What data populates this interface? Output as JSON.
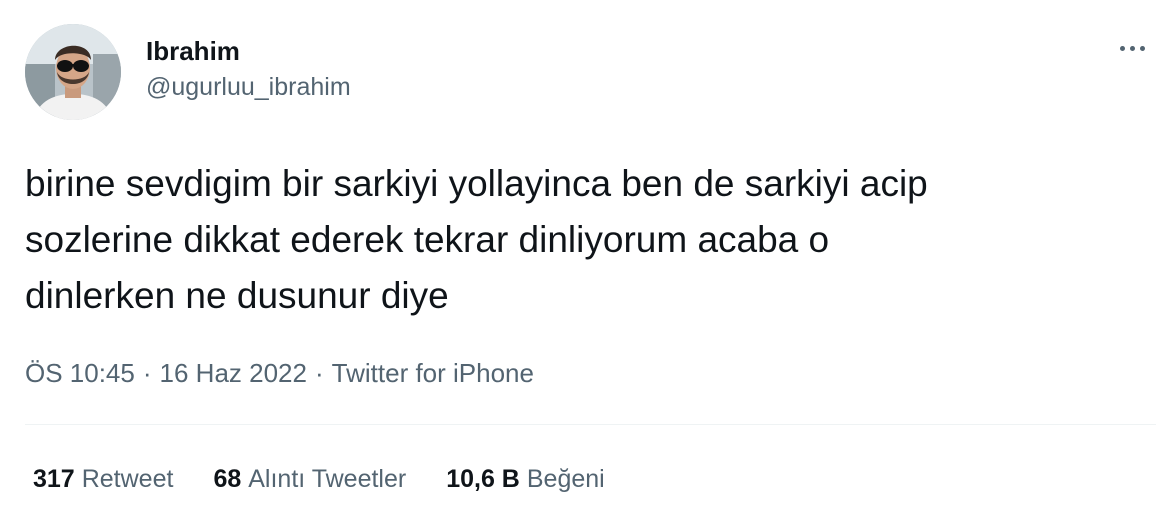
{
  "author": {
    "display_name": "Ibrahim",
    "handle": "@ugurluu_ibrahim",
    "avatar_icon": "user-avatar-photo"
  },
  "more_icon": "more-horizontal-icon",
  "tweet": {
    "text": "birine sevdigim bir sarkiyi yollayinca ben de sarkiyi acip\nsozlerine dikkat ederek tekrar dinliyorum acaba o\ndinlerken ne dusunur diye"
  },
  "meta": {
    "time": "ÖS 10:45",
    "separator": "·",
    "date": "16 Haz 2022",
    "source": "Twitter for iPhone"
  },
  "stats": {
    "retweets": {
      "count": "317",
      "label": "Retweet"
    },
    "quotes": {
      "count": "68",
      "label": "Alıntı Tweetler"
    },
    "likes": {
      "count": "10,6 B",
      "label": "Beğeni"
    }
  },
  "colors": {
    "text_primary": "#0f1419",
    "text_secondary": "#536471",
    "divider": "#eff3f4"
  }
}
